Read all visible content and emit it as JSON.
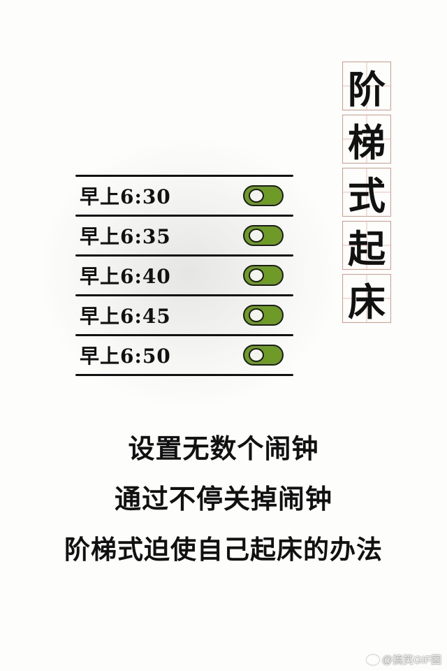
{
  "title": {
    "chars": [
      "阶",
      "梯",
      "式",
      "起",
      "床"
    ]
  },
  "alarms": [
    {
      "time": "早上6:30",
      "on": true
    },
    {
      "time": "早上6:35",
      "on": true
    },
    {
      "time": "早上6:40",
      "on": true
    },
    {
      "time": "早上6:45",
      "on": true
    },
    {
      "time": "早上6:50",
      "on": true
    }
  ],
  "caption": {
    "line1": "设置无数个闹钟",
    "line2": "通过不停关掉闹钟",
    "line3": "阶梯式迫使自己起床的办法"
  },
  "watermark": {
    "text": "@搞笑GIF图",
    "icon": "weibo-icon"
  },
  "colors": {
    "toggle_on": "#6e9a27",
    "title_grid": "#d99a8c"
  }
}
